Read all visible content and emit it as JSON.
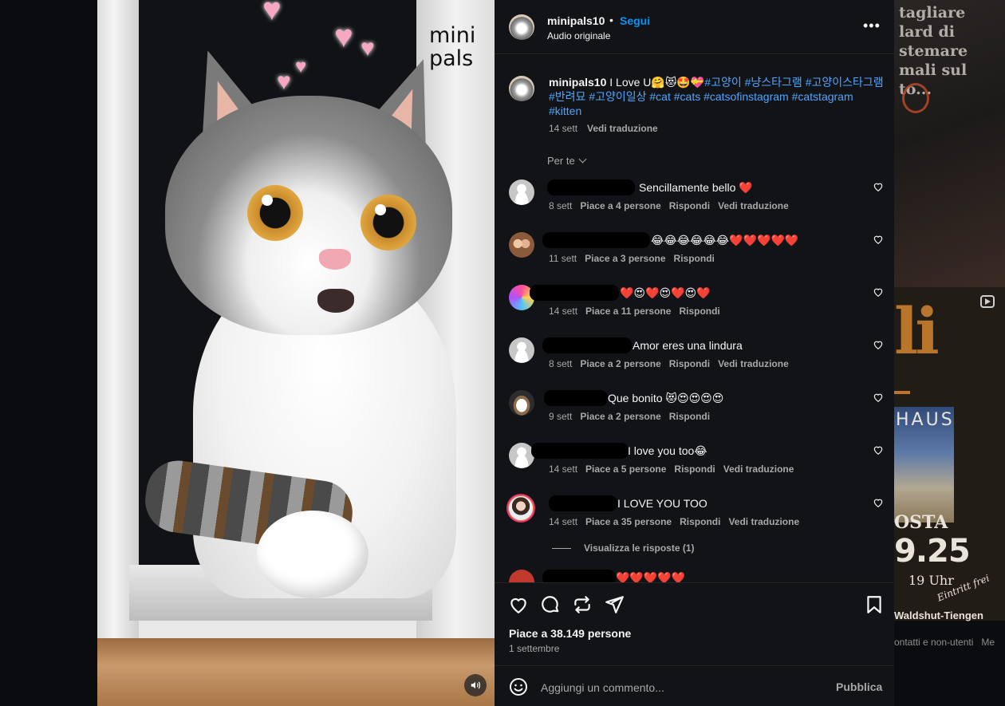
{
  "background": {
    "right_post_text": "tagliare\nlard di\nstemare\nmali sul\nto...",
    "right_big": "li",
    "right_haus": "HAUS",
    "right_osta": "OSTA",
    "right_date": "9.25",
    "right_uhr": "19 Uhr",
    "right_eintritt": "Eintritt frei",
    "right_wald": "Waldshut-Tiengen",
    "right_footer": "ontatti e non-utenti   Me"
  },
  "media": {
    "watermark": "mini\npals",
    "hearts": [
      "♥",
      "♥",
      "♥",
      "♥",
      "♥"
    ],
    "mute_icon": "speaker-icon"
  },
  "header": {
    "username": "minipals10",
    "separator": "•",
    "follow_label": "Segui",
    "audio": "Audio originale",
    "more_label": "•••"
  },
  "caption": {
    "username": "minipals10",
    "text": " I Love U🤗😻🤩💝",
    "hashtags": "#고양이 #냥스타그램 #고양이스타그램 #반려묘 #고양이일상 #cat #cats #catsofinstagram #catstagram #kitten",
    "time": "14 sett",
    "translate": "Vedi traduzione"
  },
  "filter": {
    "label": "Per te"
  },
  "comments": [
    {
      "text": "Sencillamente bello ❤️",
      "time": "8 sett",
      "likes": "Piace a 4 persone",
      "reply": "Rispondi",
      "translate": "Vedi traduzione"
    },
    {
      "text": "😂😂😂😂😂😂❤️❤️❤️❤️❤️",
      "time": "11 sett",
      "likes": "Piace a 3 persone",
      "reply": "Rispondi",
      "translate": ""
    },
    {
      "text": "❤️😍❤️😍❤️😍❤️",
      "time": "14 sett",
      "likes": "Piace a 11 persone",
      "reply": "Rispondi",
      "translate": ""
    },
    {
      "text": "Amor eres una lindura",
      "time": "8 sett",
      "likes": "Piace a 2 persone",
      "reply": "Rispondi",
      "translate": "Vedi traduzione"
    },
    {
      "text": "Que bonito 😻😍😍😍😍",
      "time": "9 sett",
      "likes": "Piace a 2 persone",
      "reply": "Rispondi",
      "translate": ""
    },
    {
      "text": "I love you too😂",
      "time": "14 sett",
      "likes": "Piace a 5 persone",
      "reply": "Rispondi",
      "translate": "Vedi traduzione"
    },
    {
      "text": "I LOVE YOU TOO",
      "time": "14 sett",
      "likes": "Piace a 35 persone",
      "reply": "Rispondi",
      "translate": "Vedi traduzione"
    },
    {
      "text": "❤️❤️❤️❤️❤️",
      "time": "",
      "likes": "",
      "reply": "",
      "translate": ""
    }
  ],
  "replies": {
    "label": "Visualizza le risposte (1)"
  },
  "actions": {
    "icons": [
      "heart-icon",
      "comment-icon",
      "repost-icon",
      "share-icon",
      "bookmark-icon"
    ],
    "likes": "Piace a 38.149 persone",
    "date": "1 settembre"
  },
  "composer": {
    "placeholder": "Aggiungi un commento...",
    "publish": "Pubblica"
  }
}
